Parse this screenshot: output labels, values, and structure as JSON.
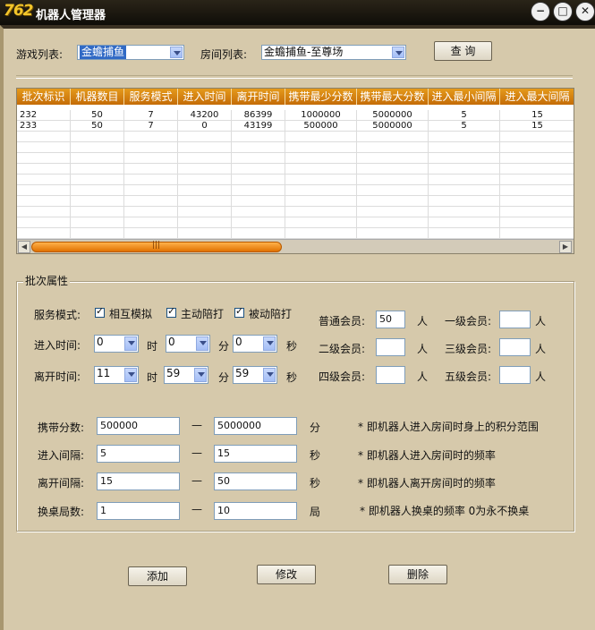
{
  "window": {
    "logo": "762",
    "title": "机器人管理器",
    "minimize": "−",
    "maximize": "□",
    "close": "✕"
  },
  "filters": {
    "game_label": "游戏列表:",
    "game_value": "金蟾捕鱼",
    "room_label": "房间列表:",
    "room_value": "金蟾捕鱼-至尊场",
    "query_button": "查 询"
  },
  "table": {
    "headers": [
      "批次标识",
      "机器数目",
      "服务模式",
      "进入时间",
      "离开时间",
      "携带最少分数",
      "携带最大分数",
      "进入最小间隔",
      "进入最大间隔"
    ],
    "rows": [
      [
        "232",
        "50",
        "7",
        "43200",
        "86399",
        "1000000",
        "5000000",
        "5",
        "15"
      ],
      [
        "233",
        "50",
        "7",
        "0",
        "43199",
        "500000",
        "5000000",
        "5",
        "15"
      ]
    ]
  },
  "batch": {
    "group_title": "批次属性",
    "service_mode_label": "服务模式:",
    "mode_opt1": "相互模拟",
    "mode_opt2": "主动陪打",
    "mode_opt3": "被动陪打",
    "enter_time_label": "进入时间:",
    "leave_time_label": "离开时间:",
    "hour_unit": "时",
    "minute_unit": "分",
    "second_unit": "秒",
    "enter_hour": "0",
    "enter_minute": "0",
    "enter_second": "0",
    "leave_hour": "11",
    "leave_minute": "59",
    "leave_second": "59",
    "normal_member_label": "普通会员:",
    "normal_member_value": "50",
    "level1_label": "一级会员:",
    "level2_label": "二级会员:",
    "level3_label": "三级会员:",
    "level4_label": "四级会员:",
    "level5_label": "五级会员:",
    "person_unit": "人",
    "score_label": "携带分数:",
    "score_min": "500000",
    "score_max": "5000000",
    "score_unit": "分",
    "score_hint": "* 即机器人进入房间时身上的积分范围",
    "enter_interval_label": "进入间隔:",
    "enter_interval_min": "5",
    "enter_interval_max": "15",
    "enter_interval_unit": "秒",
    "enter_interval_hint": "* 即机器人进入房间时的频率",
    "leave_interval_label": "离开间隔:",
    "leave_interval_min": "15",
    "leave_interval_max": "50",
    "leave_interval_unit": "秒",
    "leave_interval_hint": "* 即机器人离开房间时的频率",
    "swap_label": "换桌局数:",
    "swap_min": "1",
    "swap_max": "10",
    "swap_unit": "局",
    "swap_hint": "* 即机器人换桌的频率 0为永不换桌",
    "dash": "—"
  },
  "actions": {
    "add": "添加",
    "modify": "修改",
    "delete": "删除"
  }
}
